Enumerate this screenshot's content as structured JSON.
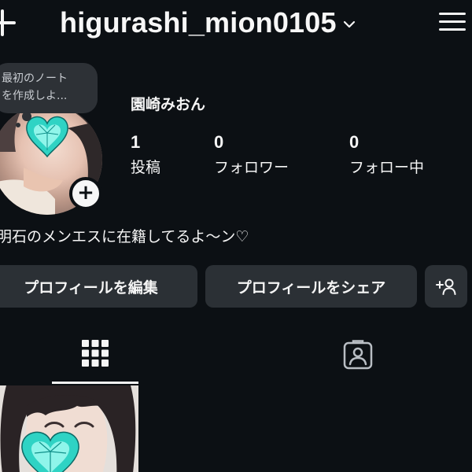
{
  "header": {
    "username": "higurashi_mion0105"
  },
  "note": {
    "line1": "最初のノート",
    "line2": "を作成しよ..."
  },
  "profile": {
    "display_name": "園崎みおん",
    "bio": "明石のメンエスに在籍してるよ～ン♡",
    "stats": {
      "posts": {
        "value": "1",
        "label": "投稿"
      },
      "followers": {
        "value": "0",
        "label": "フォロワー"
      },
      "following": {
        "value": "0",
        "label": "フォロー中"
      }
    }
  },
  "buttons": {
    "edit": "プロフィールを編集",
    "share": "プロフィールをシェア"
  },
  "icons": {
    "create": "plus-icon",
    "menu": "hamburger-menu-icon",
    "chevron": "chevron-down-icon",
    "add_story": "plus-icon",
    "add_user": "add-person-icon",
    "grid": "grid-icon",
    "tagged": "tagged-person-icon"
  },
  "colors": {
    "background": "#0c1014",
    "button": "#2b3035",
    "bubble": "#2d3136",
    "text": "#f5f5f5",
    "heart": "#3fe0d0"
  }
}
